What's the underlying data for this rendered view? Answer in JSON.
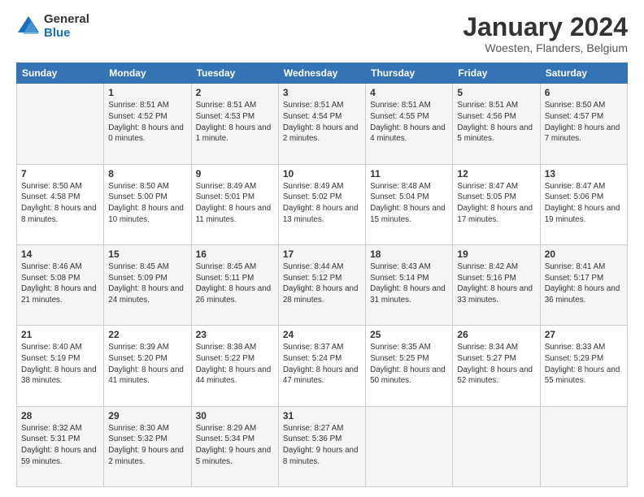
{
  "logo": {
    "general": "General",
    "blue": "Blue"
  },
  "title": "January 2024",
  "location": "Woesten, Flanders, Belgium",
  "days_of_week": [
    "Sunday",
    "Monday",
    "Tuesday",
    "Wednesday",
    "Thursday",
    "Friday",
    "Saturday"
  ],
  "weeks": [
    [
      {
        "day": "",
        "sunrise": "",
        "sunset": "",
        "daylight": ""
      },
      {
        "day": "1",
        "sunrise": "Sunrise: 8:51 AM",
        "sunset": "Sunset: 4:52 PM",
        "daylight": "Daylight: 8 hours and 0 minutes."
      },
      {
        "day": "2",
        "sunrise": "Sunrise: 8:51 AM",
        "sunset": "Sunset: 4:53 PM",
        "daylight": "Daylight: 8 hours and 1 minute."
      },
      {
        "day": "3",
        "sunrise": "Sunrise: 8:51 AM",
        "sunset": "Sunset: 4:54 PM",
        "daylight": "Daylight: 8 hours and 2 minutes."
      },
      {
        "day": "4",
        "sunrise": "Sunrise: 8:51 AM",
        "sunset": "Sunset: 4:55 PM",
        "daylight": "Daylight: 8 hours and 4 minutes."
      },
      {
        "day": "5",
        "sunrise": "Sunrise: 8:51 AM",
        "sunset": "Sunset: 4:56 PM",
        "daylight": "Daylight: 8 hours and 5 minutes."
      },
      {
        "day": "6",
        "sunrise": "Sunrise: 8:50 AM",
        "sunset": "Sunset: 4:57 PM",
        "daylight": "Daylight: 8 hours and 7 minutes."
      }
    ],
    [
      {
        "day": "7",
        "sunrise": "Sunrise: 8:50 AM",
        "sunset": "Sunset: 4:58 PM",
        "daylight": "Daylight: 8 hours and 8 minutes."
      },
      {
        "day": "8",
        "sunrise": "Sunrise: 8:50 AM",
        "sunset": "Sunset: 5:00 PM",
        "daylight": "Daylight: 8 hours and 10 minutes."
      },
      {
        "day": "9",
        "sunrise": "Sunrise: 8:49 AM",
        "sunset": "Sunset: 5:01 PM",
        "daylight": "Daylight: 8 hours and 11 minutes."
      },
      {
        "day": "10",
        "sunrise": "Sunrise: 8:49 AM",
        "sunset": "Sunset: 5:02 PM",
        "daylight": "Daylight: 8 hours and 13 minutes."
      },
      {
        "day": "11",
        "sunrise": "Sunrise: 8:48 AM",
        "sunset": "Sunset: 5:04 PM",
        "daylight": "Daylight: 8 hours and 15 minutes."
      },
      {
        "day": "12",
        "sunrise": "Sunrise: 8:47 AM",
        "sunset": "Sunset: 5:05 PM",
        "daylight": "Daylight: 8 hours and 17 minutes."
      },
      {
        "day": "13",
        "sunrise": "Sunrise: 8:47 AM",
        "sunset": "Sunset: 5:06 PM",
        "daylight": "Daylight: 8 hours and 19 minutes."
      }
    ],
    [
      {
        "day": "14",
        "sunrise": "Sunrise: 8:46 AM",
        "sunset": "Sunset: 5:08 PM",
        "daylight": "Daylight: 8 hours and 21 minutes."
      },
      {
        "day": "15",
        "sunrise": "Sunrise: 8:45 AM",
        "sunset": "Sunset: 5:09 PM",
        "daylight": "Daylight: 8 hours and 24 minutes."
      },
      {
        "day": "16",
        "sunrise": "Sunrise: 8:45 AM",
        "sunset": "Sunset: 5:11 PM",
        "daylight": "Daylight: 8 hours and 26 minutes."
      },
      {
        "day": "17",
        "sunrise": "Sunrise: 8:44 AM",
        "sunset": "Sunset: 5:12 PM",
        "daylight": "Daylight: 8 hours and 28 minutes."
      },
      {
        "day": "18",
        "sunrise": "Sunrise: 8:43 AM",
        "sunset": "Sunset: 5:14 PM",
        "daylight": "Daylight: 8 hours and 31 minutes."
      },
      {
        "day": "19",
        "sunrise": "Sunrise: 8:42 AM",
        "sunset": "Sunset: 5:16 PM",
        "daylight": "Daylight: 8 hours and 33 minutes."
      },
      {
        "day": "20",
        "sunrise": "Sunrise: 8:41 AM",
        "sunset": "Sunset: 5:17 PM",
        "daylight": "Daylight: 8 hours and 36 minutes."
      }
    ],
    [
      {
        "day": "21",
        "sunrise": "Sunrise: 8:40 AM",
        "sunset": "Sunset: 5:19 PM",
        "daylight": "Daylight: 8 hours and 38 minutes."
      },
      {
        "day": "22",
        "sunrise": "Sunrise: 8:39 AM",
        "sunset": "Sunset: 5:20 PM",
        "daylight": "Daylight: 8 hours and 41 minutes."
      },
      {
        "day": "23",
        "sunrise": "Sunrise: 8:38 AM",
        "sunset": "Sunset: 5:22 PM",
        "daylight": "Daylight: 8 hours and 44 minutes."
      },
      {
        "day": "24",
        "sunrise": "Sunrise: 8:37 AM",
        "sunset": "Sunset: 5:24 PM",
        "daylight": "Daylight: 8 hours and 47 minutes."
      },
      {
        "day": "25",
        "sunrise": "Sunrise: 8:35 AM",
        "sunset": "Sunset: 5:25 PM",
        "daylight": "Daylight: 8 hours and 50 minutes."
      },
      {
        "day": "26",
        "sunrise": "Sunrise: 8:34 AM",
        "sunset": "Sunset: 5:27 PM",
        "daylight": "Daylight: 8 hours and 52 minutes."
      },
      {
        "day": "27",
        "sunrise": "Sunrise: 8:33 AM",
        "sunset": "Sunset: 5:29 PM",
        "daylight": "Daylight: 8 hours and 55 minutes."
      }
    ],
    [
      {
        "day": "28",
        "sunrise": "Sunrise: 8:32 AM",
        "sunset": "Sunset: 5:31 PM",
        "daylight": "Daylight: 8 hours and 59 minutes."
      },
      {
        "day": "29",
        "sunrise": "Sunrise: 8:30 AM",
        "sunset": "Sunset: 5:32 PM",
        "daylight": "Daylight: 9 hours and 2 minutes."
      },
      {
        "day": "30",
        "sunrise": "Sunrise: 8:29 AM",
        "sunset": "Sunset: 5:34 PM",
        "daylight": "Daylight: 9 hours and 5 minutes."
      },
      {
        "day": "31",
        "sunrise": "Sunrise: 8:27 AM",
        "sunset": "Sunset: 5:36 PM",
        "daylight": "Daylight: 9 hours and 8 minutes."
      },
      {
        "day": "",
        "sunrise": "",
        "sunset": "",
        "daylight": ""
      },
      {
        "day": "",
        "sunrise": "",
        "sunset": "",
        "daylight": ""
      },
      {
        "day": "",
        "sunrise": "",
        "sunset": "",
        "daylight": ""
      }
    ]
  ]
}
